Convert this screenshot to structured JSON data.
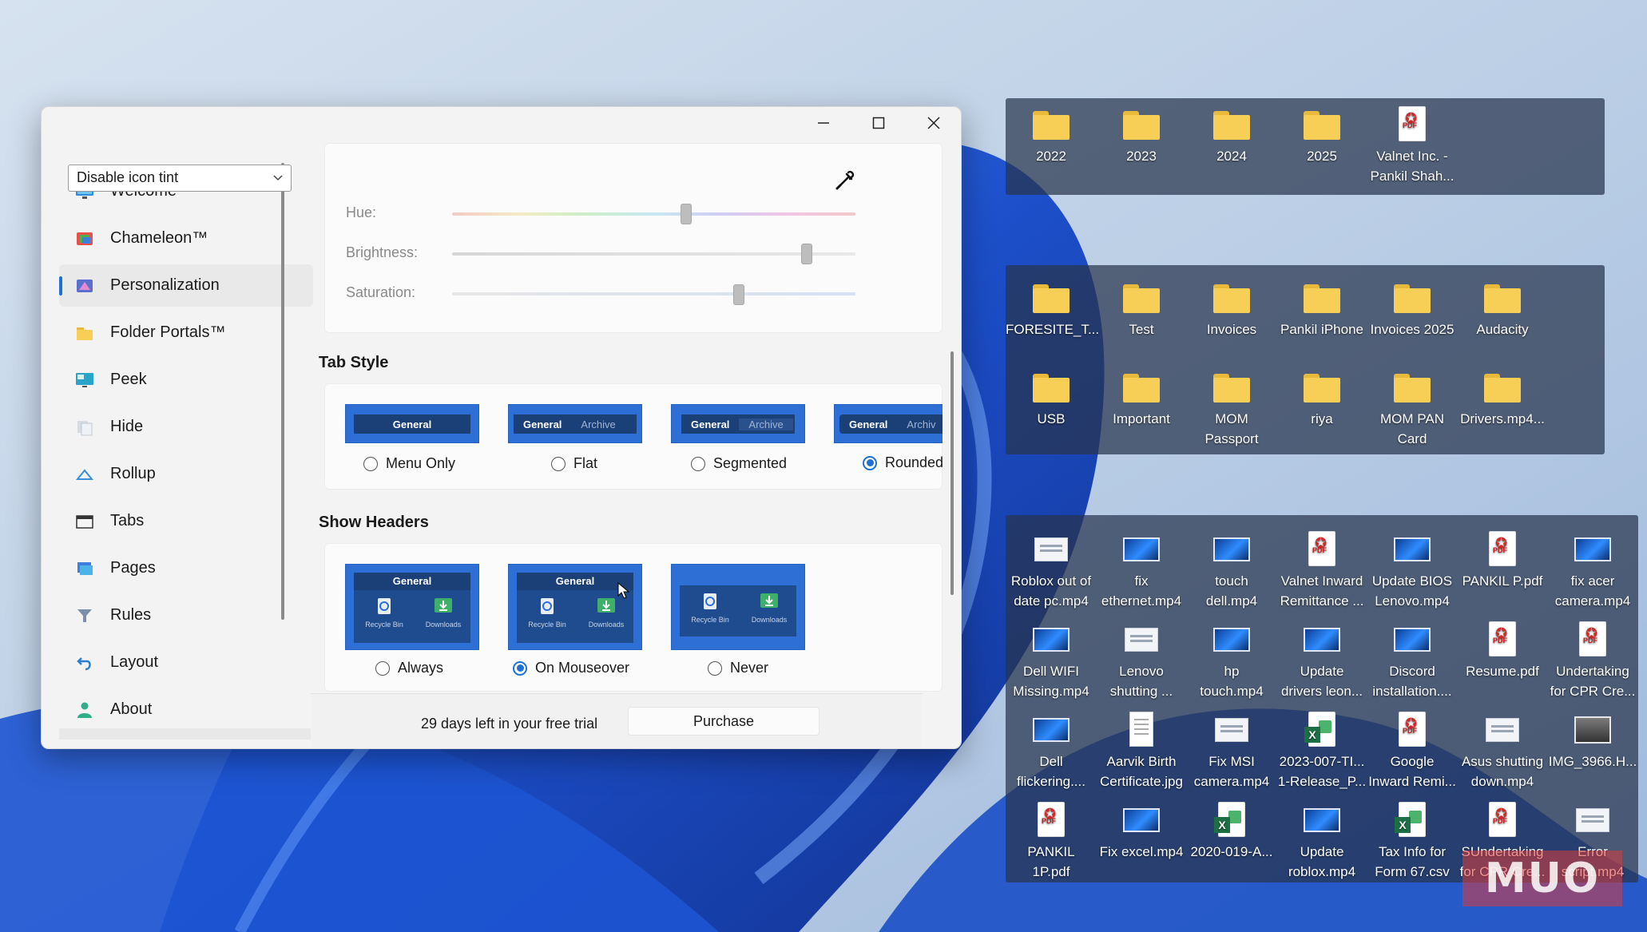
{
  "window": {
    "sidebar": {
      "items": [
        {
          "label": "Welcome",
          "icon": "monitor-icon",
          "active": false
        },
        {
          "label": "Chameleon™",
          "icon": "chameleon-icon",
          "active": false
        },
        {
          "label": "Personalization",
          "icon": "palette-icon",
          "active": true
        },
        {
          "label": "Folder Portals™",
          "icon": "folder-icon",
          "active": false
        },
        {
          "label": "Peek",
          "icon": "desktop-icon",
          "active": false
        },
        {
          "label": "Hide",
          "icon": "hide-icon",
          "active": false
        },
        {
          "label": "Rollup",
          "icon": "rollup-icon",
          "active": false
        },
        {
          "label": "Tabs",
          "icon": "tabs-icon",
          "active": false
        },
        {
          "label": "Pages",
          "icon": "pages-icon",
          "active": false
        },
        {
          "label": "Rules",
          "icon": "funnel-icon",
          "active": false
        },
        {
          "label": "Layout",
          "icon": "undo-arrow-icon",
          "active": false
        },
        {
          "label": "About",
          "icon": "person-icon",
          "active": false
        }
      ]
    },
    "icon_tint": {
      "selected": "Disable icon tint",
      "hue_label": "Hue:",
      "brightness_label": "Brightness:",
      "saturation_label": "Saturation:",
      "hue_value": 0.58,
      "brightness_value": 0.88,
      "saturation_value": 0.71
    },
    "tab_style": {
      "title": "Tab Style",
      "tab_general": "General",
      "tab_archive": "Archive",
      "tab_archive_cut": "Archiv",
      "options": [
        {
          "label": "Menu Only",
          "selected": false
        },
        {
          "label": "Flat",
          "selected": false
        },
        {
          "label": "Segmented",
          "selected": false
        },
        {
          "label": "Rounded",
          "selected": true
        }
      ]
    },
    "show_headers": {
      "title": "Show Headers",
      "header_label": "General",
      "recycle_label": "Recycle Bin",
      "downloads_label": "Downloads",
      "options": [
        {
          "label": "Always",
          "selected": false
        },
        {
          "label": "On Mouseover",
          "selected": true
        },
        {
          "label": "Never",
          "selected": false
        }
      ]
    },
    "trial": {
      "text": "29 days left in your free trial",
      "purchase_label": "Purchase"
    }
  },
  "fences": {
    "top": [
      {
        "label": "2022",
        "type": "folder"
      },
      {
        "label": "2023",
        "type": "folder"
      },
      {
        "label": "2024",
        "type": "folder"
      },
      {
        "label": "2025",
        "type": "folder"
      },
      {
        "label": "Valnet Inc. -\nPankil Shah...",
        "type": "pdf"
      }
    ],
    "middle": [
      {
        "label": "FORESITE_T...",
        "type": "folder"
      },
      {
        "label": "Test",
        "type": "folder"
      },
      {
        "label": "Invoices",
        "type": "folder"
      },
      {
        "label": "Pankil iPhone",
        "type": "folder"
      },
      {
        "label": "Invoices 2025",
        "type": "folder"
      },
      {
        "label": "Audacity",
        "type": "folder"
      },
      {
        "label": "USB",
        "type": "folder"
      },
      {
        "label": "Important",
        "type": "folder"
      },
      {
        "label": "MOM\nPassport",
        "type": "folder"
      },
      {
        "label": "riya",
        "type": "folder"
      },
      {
        "label": "MOM PAN\nCard",
        "type": "folder"
      },
      {
        "label": "Drivers.mp4...",
        "type": "folder"
      }
    ],
    "bottom": [
      {
        "label": "Roblox out of\ndate pc.mp4",
        "type": "doc"
      },
      {
        "label": "fix\nethernet.mp4",
        "type": "video"
      },
      {
        "label": "touch\ndell.mp4",
        "type": "video"
      },
      {
        "label": "Valnet Inward\nRemittance ...",
        "type": "pdf"
      },
      {
        "label": "Update BIOS\nLenovo.mp4",
        "type": "video"
      },
      {
        "label": "PANKIL P.pdf",
        "type": "pdf"
      },
      {
        "label": "fix acer\ncamera.mp4",
        "type": "video"
      },
      {
        "label": "Dell WIFI\nMissing.mp4",
        "type": "video"
      },
      {
        "label": "Lenovo\nshutting ...",
        "type": "doc"
      },
      {
        "label": "hp\ntouch.mp4",
        "type": "video"
      },
      {
        "label": "Update\ndrivers leon...",
        "type": "video"
      },
      {
        "label": "Discord\ninstallation....",
        "type": "video"
      },
      {
        "label": "Resume.pdf",
        "type": "pdf"
      },
      {
        "label": "Undertaking\nfor CPR Cre...",
        "type": "pdf"
      },
      {
        "label": "Dell\nflickering....",
        "type": "video"
      },
      {
        "label": "Aarvik Birth\nCertificate.jpg",
        "type": "jpg"
      },
      {
        "label": "Fix MSI\ncamera.mp4",
        "type": "doc"
      },
      {
        "label": "2023-007-TI...\n1-Release_P...",
        "type": "excel"
      },
      {
        "label": "Google\nInward Remi...",
        "type": "pdf"
      },
      {
        "label": "Asus shutting\ndown.mp4",
        "type": "doc"
      },
      {
        "label": "IMG_3966.H...",
        "type": "photo"
      },
      {
        "label": "PANKIL\n1P.pdf",
        "type": "pdf"
      },
      {
        "label": "Fix excel.mp4",
        "type": "video"
      },
      {
        "label": "2020-019-A...",
        "type": "excel"
      },
      {
        "label": "Update\nroblox.mp4",
        "type": "video"
      },
      {
        "label": "Tax Info for\nForm 67.csv",
        "type": "excel"
      },
      {
        "label": "SUndertaking\nfor CPR Cre...",
        "type": "pdf"
      },
      {
        "label": "Error\nscript.mp4",
        "type": "doc"
      }
    ]
  },
  "watermark": "MUO",
  "colors": {
    "accent": "#1f6fd6",
    "fence_bg": "#28344e",
    "folder": "#f7cf56",
    "wallpaper_blue": "#1e5fd6"
  }
}
